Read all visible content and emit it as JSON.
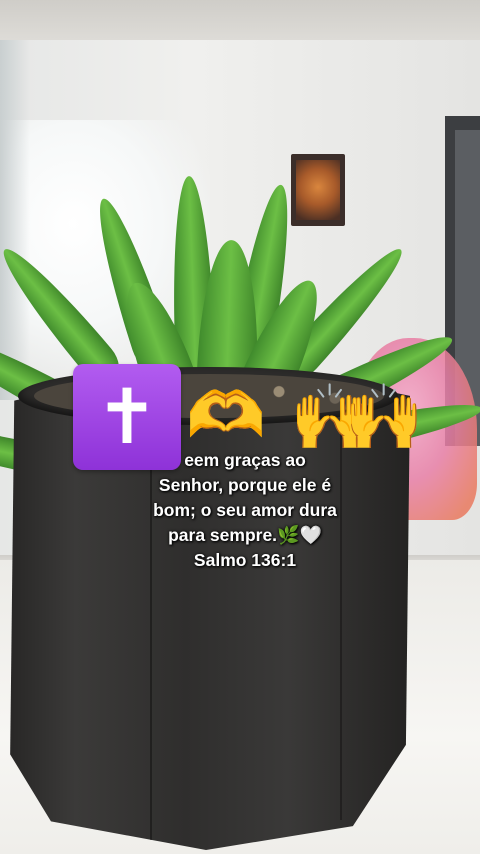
{
  "overlay": {
    "icons": {
      "cross": "latin-cross-icon",
      "heart_hands": "heart-hands-icon",
      "raised_hands": "raising-hands-icon",
      "herb": "herb-icon",
      "white_heart": "white-heart-icon"
    },
    "cross_glyph": "✝",
    "heart_hands_glyph": "🫶",
    "raised_hands_glyph": "🙌",
    "herb_glyph": "🌿",
    "white_heart_glyph": "🤍",
    "caption": {
      "line1": "eem graças ao",
      "line2": "Senhor, porque ele é",
      "line3": "bom; o seu amor dura",
      "line4": "para sempre.",
      "line5": "Salmo 136:1"
    }
  },
  "colors": {
    "cross_box": "#9b3fe0",
    "caption_text": "#ffffff"
  }
}
